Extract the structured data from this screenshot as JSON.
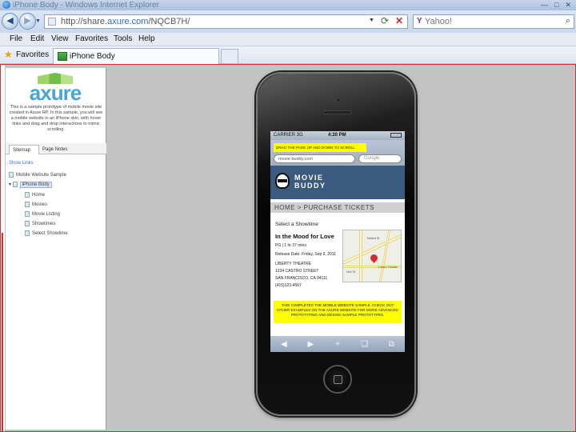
{
  "window": {
    "title": "iPhone Body - Windows Internet Explorer",
    "controls": [
      "—",
      "□",
      "✕"
    ]
  },
  "address_bar": {
    "url_prefix": "http://share.",
    "url_host": "axure.com",
    "url_path": "/NQCB7H/",
    "search_placeholder": "Yahoo!"
  },
  "menu": [
    "File",
    "Edit",
    "View",
    "Favorites",
    "Tools",
    "Help"
  ],
  "favorites_bar": {
    "favorites_label": "Favorites",
    "tab_label": "iPhone Body"
  },
  "sidebar": {
    "logo_text": "axure",
    "description": "This is a sample prototype of mobile movie site created in Axure RP. In this sample, you will see a mobile website in an iPhone skin, with hover links and drag and drop interactions to mimic scrolling.",
    "tabs": [
      "Sitemap",
      "Page Notes"
    ],
    "show_links": "Show Links",
    "tree": [
      {
        "label": "Mobile Website Sample",
        "level": 0
      },
      {
        "label": "iPhone Body",
        "level": 0,
        "selected": true
      },
      {
        "label": "Home",
        "level": 1
      },
      {
        "label": "Movies",
        "level": 1
      },
      {
        "label": "Movie Listing",
        "level": 1
      },
      {
        "label": "Showtimes",
        "level": 1
      },
      {
        "label": "Select Showtime",
        "level": 1
      }
    ]
  },
  "phone": {
    "status": {
      "carrier": "CARRIER 3G",
      "time": "4:20 PM"
    },
    "drag_note": "DRAG THE PAGE UP AND DOWN TO SCROLL",
    "url_field": "movie-buddy.com",
    "search_field": "Google",
    "brand_line1": "MOVIE",
    "brand_line2": "BUDDY",
    "breadcrumb": "HOME > PURCHASE TICKETS",
    "select_showtime": "Select a Showtime",
    "movie_title": "In the Mood for Love",
    "info": [
      "PG | 1 hr 37 mins",
      "Release Date: Friday, Sep 9, 2011",
      "LIBERTY THEATRE",
      "1234 CASTRO STREET",
      "SAN FRANCISCO, CA 94111",
      "(415)123-4567"
    ],
    "map_labels": [
      "Castro Theatre",
      "Market St",
      "Noe St"
    ],
    "bottom_note": "THIS COMPLETES THE MOBILE WEBSITE SAMPLE. CHECK OUT OTHER EXAMPLES ON THE AXURE WEBSITE FOR MORE ADVANCED PROTOTYPING AND DESIGN SAMPLE PROTOTYPES.",
    "toolbar_icons": [
      "◀",
      "▶",
      "+",
      "❏",
      "⧉"
    ]
  }
}
